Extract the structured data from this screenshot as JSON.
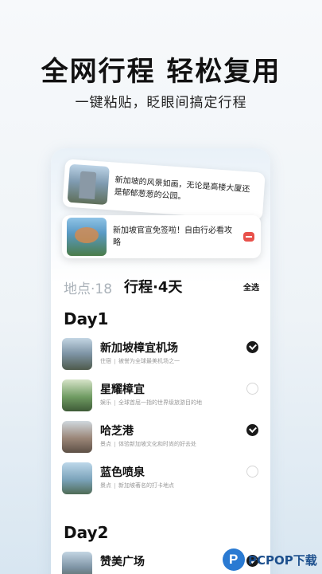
{
  "hero": {
    "headline": "全网行程 轻松复用",
    "subline": "一键粘贴，眨眼间搞定行程"
  },
  "clips": [
    {
      "text": "新加坡的风景如画，无论是高楼大厦还是郁郁葱葱的公园。",
      "image": "marina-bay-building-photo"
    },
    {
      "text": "新加坡官宣免签啦！自由行必看攻略",
      "image": "gardens-supertree-photo"
    }
  ],
  "tabs": {
    "places": "地点·18",
    "trip": "行程·4天",
    "select_all": "全选"
  },
  "days": [
    {
      "title": "Day1",
      "places": [
        {
          "name": "新加坡樟宜机场",
          "category": "住宿",
          "desc": "被誉为全球最美机场之一",
          "checked": true
        },
        {
          "name": "星耀樟宜",
          "category": "娱乐",
          "desc": "全球首屈一指的世界级旅游目的地",
          "checked": false
        },
        {
          "name": "哈芝港",
          "category": "景点",
          "desc": "体验新加坡文化和时尚的好去处",
          "checked": true
        },
        {
          "name": "蓝色喷泉",
          "category": "景点",
          "desc": "新加坡著名的打卡地点",
          "checked": false
        }
      ]
    },
    {
      "title": "Day2",
      "places": [
        {
          "name": "赞美广场",
          "category": "",
          "desc": "",
          "checked": true
        }
      ]
    }
  ],
  "watermark": {
    "text": "PCPOP下载"
  },
  "colors": {
    "accent": "#1a1a1a",
    "badge": "#e8514b",
    "watermark": "#2a7ad2"
  }
}
